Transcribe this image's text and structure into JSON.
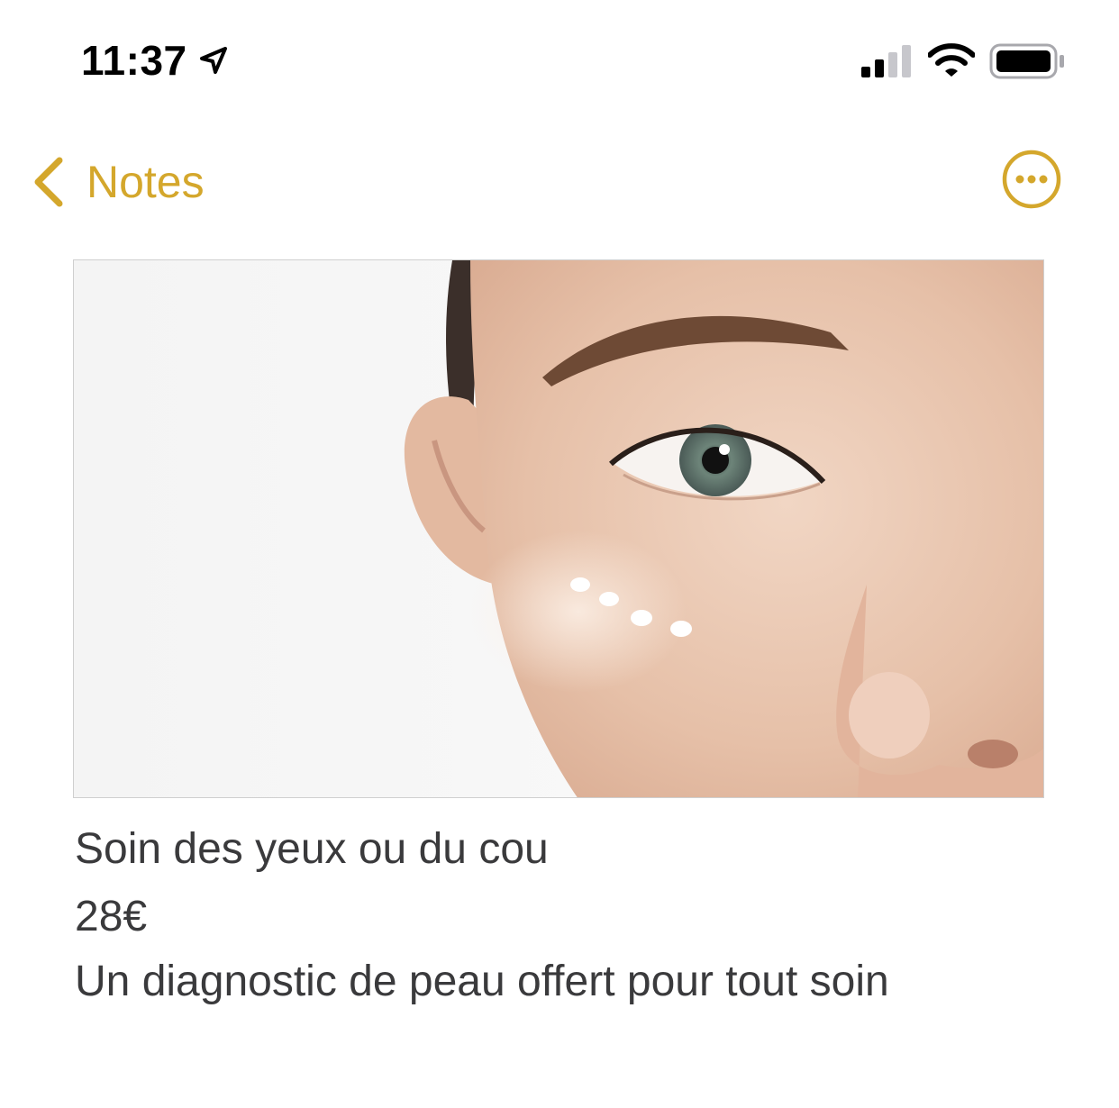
{
  "status_bar": {
    "time": "11:37",
    "location_icon": "location-arrow-icon",
    "signal_icon": "cellular-signal-icon",
    "wifi_icon": "wifi-icon",
    "battery_icon": "battery-icon"
  },
  "nav": {
    "back_label": "Notes",
    "back_icon": "chevron-left-icon",
    "more_icon": "ellipsis-circle-icon",
    "accent_color": "#d4a72c"
  },
  "note": {
    "image": "face-eye-cream-photo",
    "lines": [
      "Soin des yeux ou du cou",
      "28€",
      "Un diagnostic de peau offert pour tout soin"
    ],
    "text_color": "#3a3a3c"
  }
}
